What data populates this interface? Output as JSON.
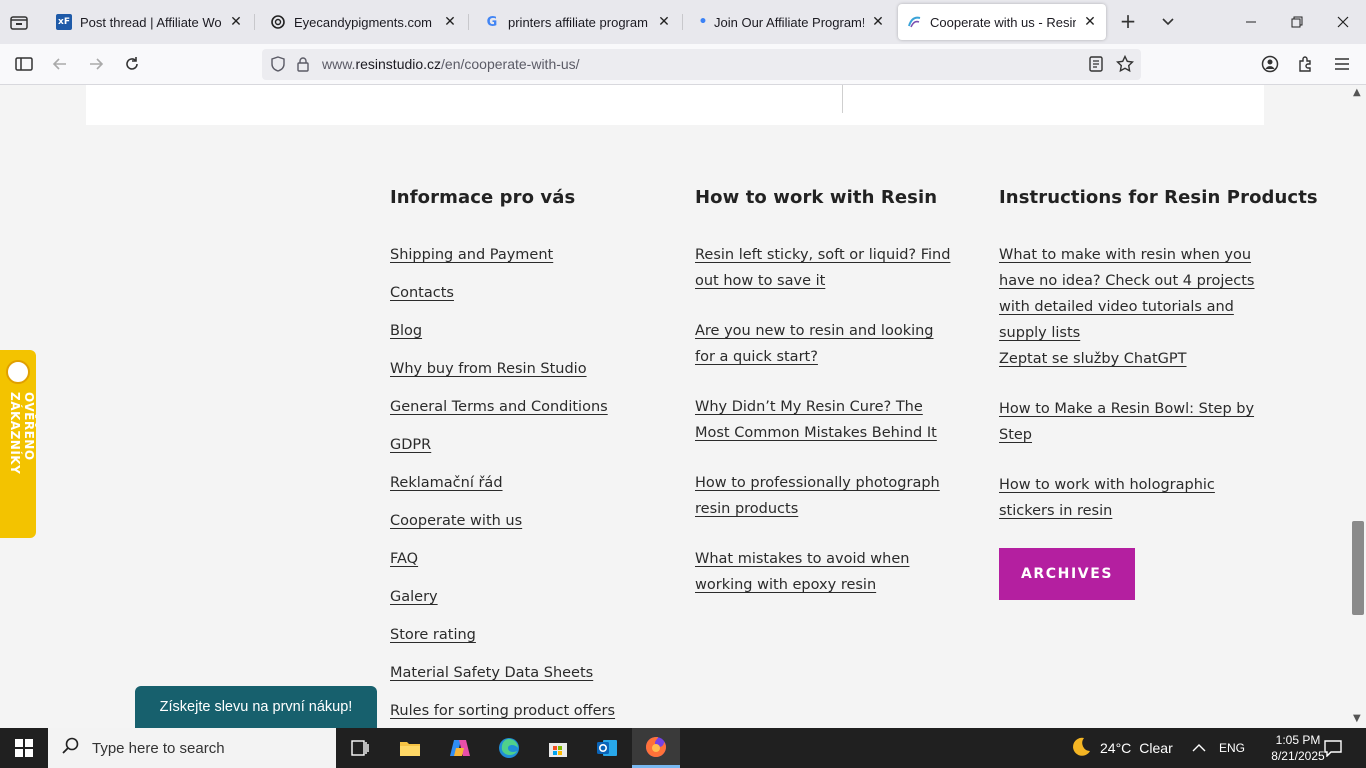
{
  "browser": {
    "tabs": [
      {
        "title": "Post thread | Affiliate World F",
        "icon": "xenforo-icon",
        "fav_text": "xF"
      },
      {
        "title": "Eyecandypigments.com review",
        "icon": "openai-icon",
        "fav_text": ""
      },
      {
        "title": "printers affiliate program - Go",
        "icon": "google-icon",
        "fav_text": "G"
      },
      {
        "title": "Join Our Affiliate Program!",
        "icon": "dot-icon",
        "fav_text": "•"
      },
      {
        "title": "Cooperate with us - Resin Stu",
        "icon": "resin-studio-icon",
        "fav_text": ""
      }
    ],
    "url_prefix": "www.",
    "url_host": "resinstudio.cz",
    "url_path": "/en/cooperate-with-us/"
  },
  "footer": {
    "col1": {
      "heading": "Informace pro vás",
      "links": [
        "Shipping and Payment",
        "Contacts",
        "Blog",
        "Why buy from Resin Studio",
        "General Terms and Conditions",
        "GDPR",
        "Reklamační řád",
        "Cooperate with us",
        "FAQ",
        "Galery",
        "Store rating",
        "Material Safety Data Sheets",
        "Rules for sorting product offers"
      ]
    },
    "col2": {
      "heading": "How to work with Resin",
      "links": [
        "Resin left sticky, soft or liquid? Find out how to save it",
        "Are you new to resin and looking for a quick start?",
        "Why Didn’t My Resin Cure? The Most Common Mistakes Behind It",
        "How to professionally photograph resin products",
        "What mistakes to avoid when working with epoxy resin"
      ]
    },
    "col3": {
      "heading": "Instructions for Resin Products",
      "links": [
        "What to make with resin when you have no idea? Check out 4 projects with detailed video tutorials and supply lists",
        "Zeptat se služby ChatGPT",
        "How to Make a Resin Bowl: Step by Step",
        "How to work with holographic stickers in resin"
      ],
      "archives_label": "ARCHIVES"
    }
  },
  "badge": {
    "label": "OVĚŘENO ZÁKAZNÍKY"
  },
  "promo": {
    "label": "Získejte slevu na první nákup!"
  },
  "taskbar": {
    "search_placeholder": "Type here to search",
    "weather_temp": "24°C",
    "weather_desc": "Clear",
    "language": "ENG",
    "time": "1:05 PM",
    "date": "8/21/2025"
  },
  "colors": {
    "archives": "#b41fa0",
    "promo": "#17606d",
    "badge": "#f3c300"
  }
}
